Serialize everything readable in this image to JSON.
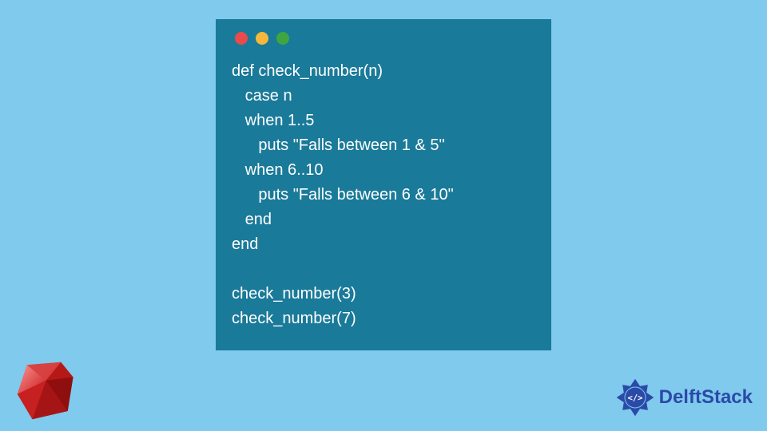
{
  "code": {
    "lines": [
      "def check_number(n)",
      "   case n",
      "   when 1..5",
      "      puts \"Falls between 1 & 5\"",
      "   when 6..10",
      "      puts \"Falls between 6 & 10\"",
      "   end",
      "end",
      "",
      "check_number(3)",
      "check_number(7)"
    ]
  },
  "brand": {
    "name": "DelftStack"
  },
  "icons": {
    "ruby": "ruby-logo",
    "delftstack_badge": "delftstack-badge"
  }
}
